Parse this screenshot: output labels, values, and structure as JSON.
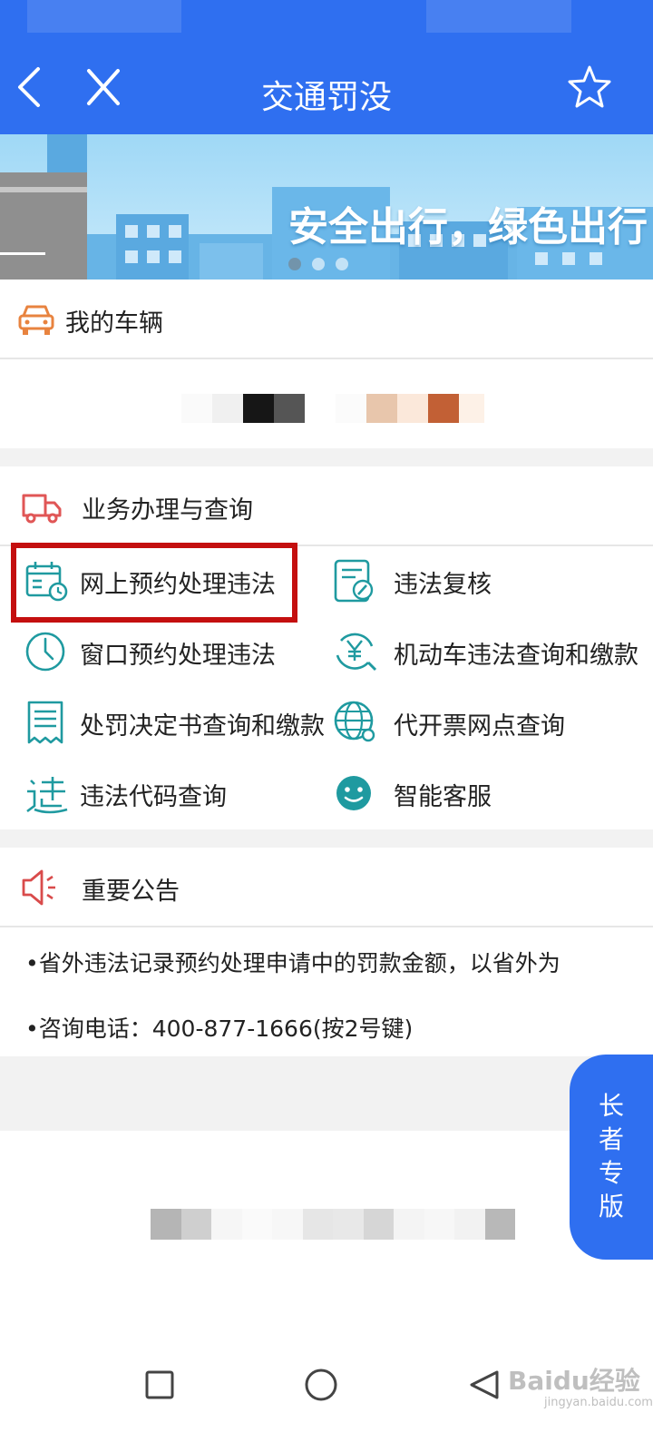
{
  "header": {
    "title": "交通罚没"
  },
  "banner": {
    "slogan": "安全出行，绿色出行"
  },
  "my_vehicle": {
    "label": "我的车辆"
  },
  "business": {
    "label": "业务办理与查询",
    "items": [
      {
        "label": "网上预约处理违法",
        "icon": "calendar-clock-icon"
      },
      {
        "label": "违法复核",
        "icon": "document-edit-icon"
      },
      {
        "label": "窗口预约处理违法",
        "icon": "clock-icon"
      },
      {
        "label": "机动车违法查询和缴款",
        "icon": "yuan-search-icon"
      },
      {
        "label": "处罚决定书查询和缴款",
        "icon": "receipt-icon"
      },
      {
        "label": "代开票网点查询",
        "icon": "globe-icon"
      },
      {
        "label": "违法代码查询",
        "icon": "violation-code-icon"
      },
      {
        "label": "智能客服",
        "icon": "smiley-icon"
      }
    ]
  },
  "announcement": {
    "label": "重要公告",
    "lines": [
      "•省外违法记录预约处理申请中的罚款金额，以省外为",
      "•咨询电话：400-877-1666(按2号键)"
    ]
  },
  "elder_mode": {
    "chars": [
      "长",
      "者",
      "专",
      "版"
    ]
  },
  "watermark": {
    "text": "Baidu经验",
    "sub": "jingyan.baidu.com"
  },
  "colors": {
    "primary": "#2f6ff0",
    "highlight_border": "#c40f0f",
    "icon_teal": "#1f9aa0",
    "car_orange": "#e8833f",
    "truck_red": "#e05656",
    "speaker_red": "#d94b4b"
  }
}
